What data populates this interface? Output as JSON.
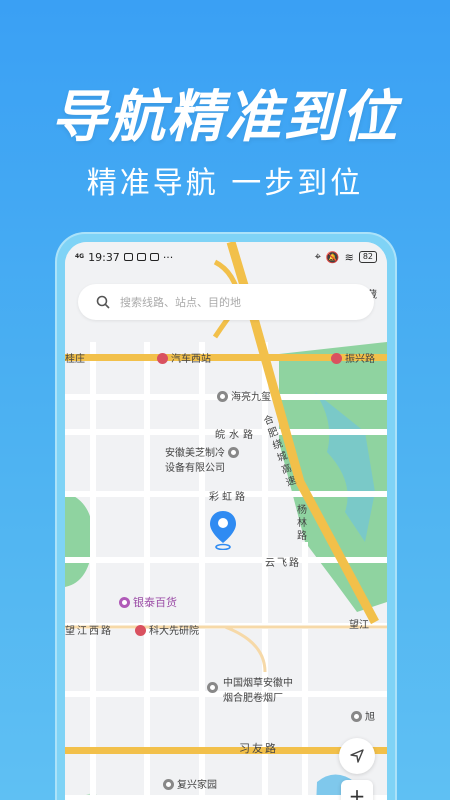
{
  "hero": {
    "title": "导航精准到位",
    "subtitle": "精准导航 一步到位"
  },
  "status": {
    "network": "4G",
    "time": "19:37",
    "more": "···",
    "battery": "82"
  },
  "search": {
    "placeholder": "搜索线路、站点、目的地"
  },
  "map": {
    "labels": {
      "huabang": "华邦藏",
      "guizhuang": "桂庄",
      "qiche_xizhan": "汽车西站",
      "zhenxing": "振兴路",
      "haiyang": "海亮九玺",
      "wanshui": "皖水路",
      "anhui_meizhi_1": "安徽美芝制冷",
      "anhui_meizhi_2": "设备有限公司",
      "caihong": "彩虹路",
      "hefei_ring_1": "合肥绕城高速",
      "yangling": "杨林路",
      "yunfei": "云飞路",
      "yintai": "银泰百货",
      "wangjiang_xi": "望江西路",
      "keda": "科大先研院",
      "wangjiang": "望江",
      "tobacco_1": "中国烟草安徽中",
      "tobacco_2": "烟合肥卷烟厂",
      "xi": "旭",
      "xiyou": "习友路",
      "fuxing": "复兴家园"
    }
  },
  "colors": {
    "accent": "#2f8bf2",
    "highway": "#f2c04a",
    "park": "#8fd3a0"
  },
  "icons": {
    "search": "search-icon",
    "pin": "location-pin-icon",
    "locate": "navigation-arrow-icon",
    "zoom": "plus-icon"
  },
  "controls": {
    "zoom_in": "+"
  }
}
